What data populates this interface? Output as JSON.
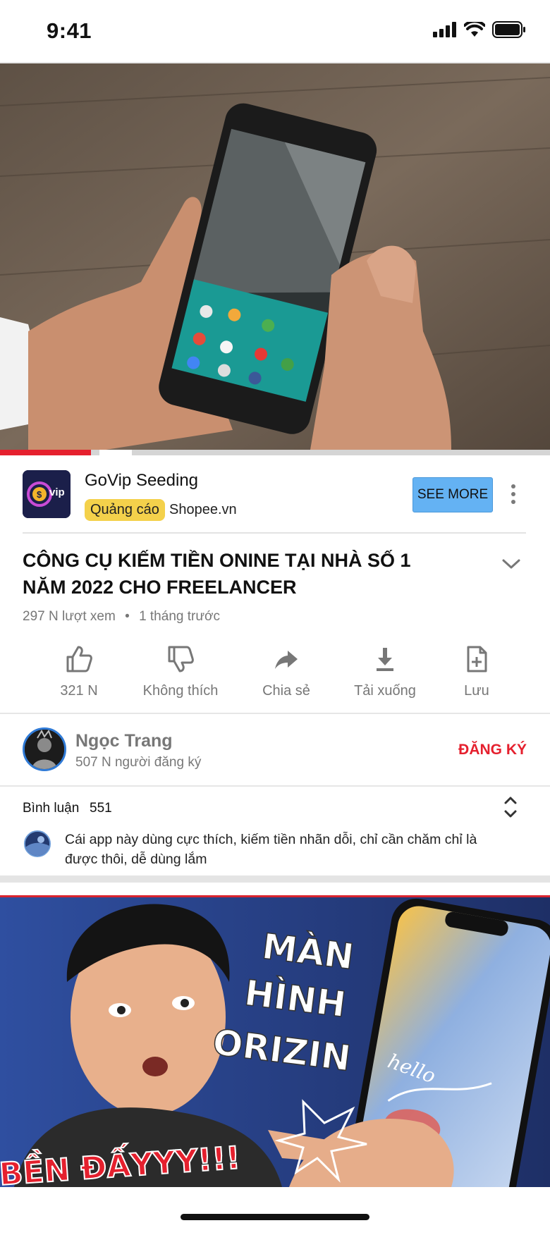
{
  "status": {
    "time": "9:41"
  },
  "ad": {
    "logo_text": "vip",
    "title": "GoVip Seeding",
    "badge": "Quảng cáo",
    "site": "Shopee.vn",
    "cta": "SEE MORE"
  },
  "video": {
    "progress_played": 0.165,
    "progress_buffered": 0.24,
    "title": "CÔNG CỤ KIẾM TIỀN ONINE TẠI NHÀ SỐ 1 NĂM 2022 CHO FREELANCER",
    "views": "297 N lượt xem",
    "time_ago": "1 tháng trước"
  },
  "actions": [
    {
      "icon": "thumbs-up-icon",
      "label": "321 N"
    },
    {
      "icon": "thumbs-down-icon",
      "label": "Không thích"
    },
    {
      "icon": "share-icon",
      "label": "Chia sẻ"
    },
    {
      "icon": "download-icon",
      "label": "Tải xuống"
    },
    {
      "icon": "save-icon",
      "label": "Lưu"
    }
  ],
  "channel": {
    "name": "Ngọc Trang",
    "subscribers": "507 N người đăng ký",
    "subscribe_label": "ĐĂNG KÝ"
  },
  "comments": {
    "label": "Bình luận",
    "count": "551",
    "top_comment": "Cái app này dùng cực thích, kiếm tiền nhãn dỗi, chỉ cần chăm chỉ là được thôi, dễ dùng lắm"
  },
  "next_video": {
    "overlay_lines": [
      "MÀN",
      "HÌNH",
      "ORIZIN"
    ],
    "bottom_text": "BỀN ĐẤYYY!!!",
    "phone_text": "hello"
  },
  "colors": {
    "accent_red": "#e5202e",
    "cta_blue": "#64b2f3",
    "badge_yellow": "#f4d14b"
  }
}
